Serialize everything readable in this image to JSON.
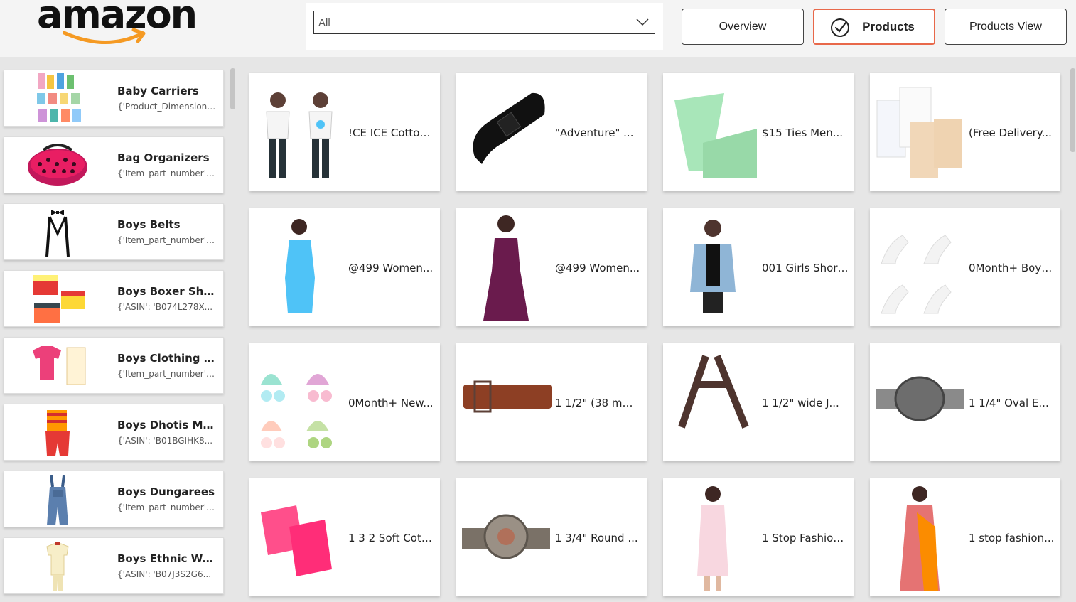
{
  "header": {
    "logo_text": "amazon",
    "filter": {
      "value": "All"
    },
    "nav": [
      {
        "label": "Overview",
        "active": false
      },
      {
        "label": "Products",
        "active": true
      },
      {
        "label": "Products View",
        "active": false
      }
    ],
    "accent_color": "#e8684a",
    "logo_smile_color": "#f59a23"
  },
  "sidebar": {
    "items": [
      {
        "title": "Baby Carriers",
        "subtitle": "{'Product_Dimensions': ...",
        "thumb": "socks-pack-icon"
      },
      {
        "title": "Bag Organizers",
        "subtitle": "{'Item_part_number': ...",
        "thumb": "bra-case-icon"
      },
      {
        "title": "Boys Belts",
        "subtitle": "{'Item_part_number': ...",
        "thumb": "suspenders-bowtie-icon"
      },
      {
        "title": "Boys Boxer Shorts",
        "subtitle": "{'ASIN': 'B074L278X...",
        "thumb": "boxer-shorts-icon"
      },
      {
        "title": "Boys Clothing Sets",
        "subtitle": "{'Item_part_number': ...",
        "thumb": "shirt-dhoti-icon"
      },
      {
        "title": "Boys Dhotis Mundus",
        "subtitle": "{'ASIN': 'B01BGIHK8...",
        "thumb": "kids-dhoti-icon"
      },
      {
        "title": "Boys Dungarees",
        "subtitle": "{'Item_part_number': ...",
        "thumb": "denim-dungaree-icon"
      },
      {
        "title": "Boys Ethnic Wear",
        "subtitle": "{'ASIN': 'B07J3S2G6...",
        "thumb": "ethnic-kurta-icon"
      }
    ]
  },
  "products": [
    {
      "label": "!CE ICE Cotton...",
      "thumb": "kids-tshirt-icon"
    },
    {
      "label": "\"Adventure\" ...",
      "thumb": "black-belt-icon"
    },
    {
      "label": "$15 Ties Men...",
      "thumb": "green-tie-icon"
    },
    {
      "label": "(Free Delivery...",
      "thumb": "bra-extender-icon"
    },
    {
      "label": "@499 Women...",
      "thumb": "blue-dress-icon"
    },
    {
      "label": "@499 Women...",
      "thumb": "purple-dress-icon"
    },
    {
      "label": "001 Girls Shorts...",
      "thumb": "denim-vest-icon"
    },
    {
      "label": "0Month+ Boys...",
      "thumb": "white-socks-icon"
    },
    {
      "label": "0Month+ New...",
      "thumb": "baby-caps-icon"
    },
    {
      "label": "1 1/2\" (38 mm...",
      "thumb": "brown-belt-icon"
    },
    {
      "label": "1 1/2\" wide J...",
      "thumb": "brown-suspenders-icon"
    },
    {
      "label": "1 1/4\" Oval E...",
      "thumb": "oval-buckle-icon"
    },
    {
      "label": "1 3 2 Soft Cotton...",
      "thumb": "pink-booties-icon"
    },
    {
      "label": "1 3/4\" Round ...",
      "thumb": "round-buckle-icon"
    },
    {
      "label": "1 Stop Fashion...",
      "thumb": "pink-kurti-icon"
    },
    {
      "label": "1 stop fashion...",
      "thumb": "saree-icon"
    }
  ]
}
